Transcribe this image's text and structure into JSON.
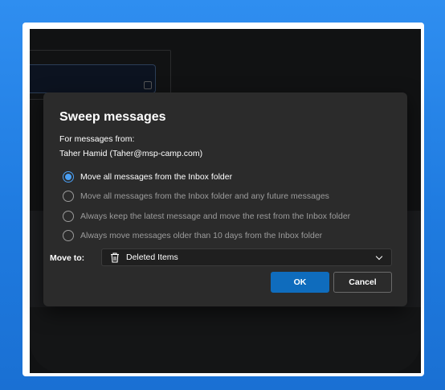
{
  "dialog": {
    "title": "Sweep messages",
    "for_label": "For messages from:",
    "sender": "Taher Hamid (Taher@msp-camp.com)",
    "options": [
      {
        "label": "Move all messages from the Inbox folder",
        "selected": true
      },
      {
        "label": "Move all messages from the Inbox folder and any future messages",
        "selected": false
      },
      {
        "label": "Always keep the latest message and move the rest from the Inbox folder",
        "selected": false
      },
      {
        "label": "Always move messages older than 10 days from the Inbox folder",
        "selected": false
      }
    ],
    "move_to_label": "Move to:",
    "move_to_value": "Deleted Items",
    "move_to_icon": "trash-icon",
    "ok_label": "OK",
    "cancel_label": "Cancel"
  },
  "colors": {
    "accent": "#0f6cbd",
    "radio_checked": "#4aa0f5",
    "dialog_bg": "#2b2b2b",
    "frame_bg": "#1f7be0"
  }
}
